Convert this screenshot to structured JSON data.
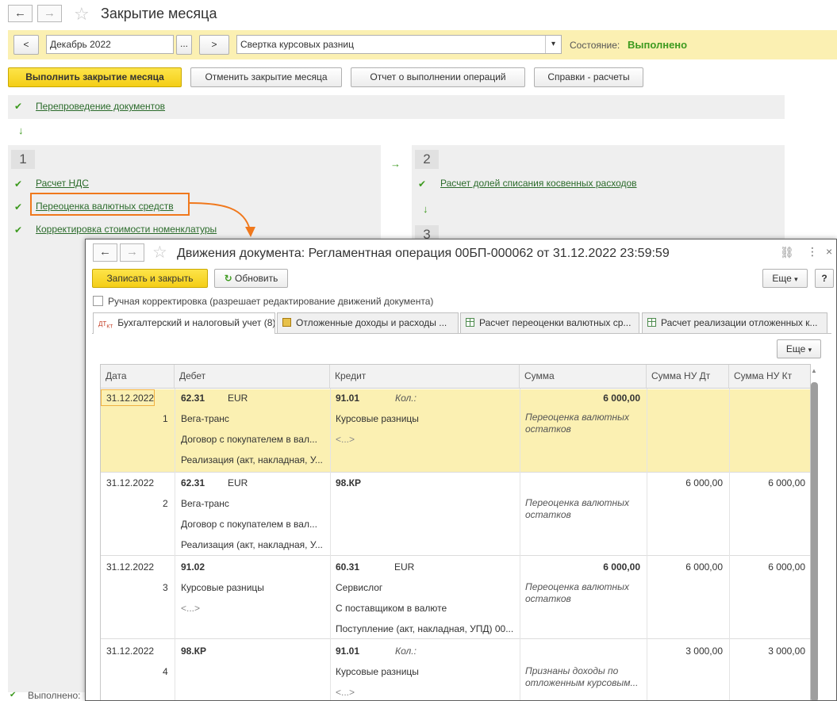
{
  "window": {
    "title": "Закрытие месяца",
    "back_icon": "←",
    "forward_icon": "→"
  },
  "period": {
    "prev_label": "<",
    "value": "Декабрь 2022",
    "select_label": "...",
    "next_label": ">"
  },
  "operation_select": {
    "value": "Свертка курсовых разниц",
    "arrow": "▾"
  },
  "status": {
    "label": "Состояние:",
    "value": "Выполнено"
  },
  "toolbar": {
    "run": "Выполнить закрытие месяца",
    "cancel": "Отменить закрытие месяца",
    "report": "Отчет о выполнении операций",
    "calc": "Справки - расчеты"
  },
  "steps": {
    "repost": "Перепроведение документов",
    "group1_number": "1",
    "group1_items": [
      "Расчет НДС",
      "Переоценка валютных средств",
      "Корректировка стоимости номенклатуры"
    ],
    "group2_number": "2",
    "group2_items": [
      "Расчет долей списания косвенных расходов"
    ],
    "group3_number": "3",
    "footer_status": "Выполнено:"
  },
  "modal": {
    "title": "Движения документа: Регламентная операция 00БП-000062 от 31.12.2022 23:59:59",
    "save_close": "Записать и закрыть",
    "refresh": "Обновить",
    "more": "Еще",
    "help": "?",
    "manual_edit": "Ручная корректировка (разрешает редактирование движений документа)",
    "tabs": [
      "Бухгалтерский и налоговый учет (8)",
      "Отложенные доходы и расходы ...",
      "Расчет переоценки валютных ср...",
      "Расчет реализации отложенных к..."
    ],
    "grid_more": "Еще",
    "columns": [
      "Дата",
      "Дебет",
      "Кредит",
      "Сумма",
      "Сумма НУ Дт",
      "Сумма НУ Кт"
    ],
    "rows": [
      {
        "date": "31.12.2022",
        "num": "1",
        "dt_account": "62.31",
        "dt_currency": "EUR",
        "dt_sub": [
          "Вега-транс",
          "Договор с покупателем в вал...",
          "Реализация (акт, накладная, У..."
        ],
        "kt_account": "91.01",
        "kt_qty": "Кол.:",
        "kt_sub": [
          "Курсовые разницы",
          "<...>"
        ],
        "sum": "6 000,00",
        "nu_dt": "",
        "nu_kt": "",
        "content": "Переоценка валютных остатков"
      },
      {
        "date": "31.12.2022",
        "num": "2",
        "dt_account": "62.31",
        "dt_currency": "EUR",
        "dt_sub": [
          "Вега-транс",
          "Договор с покупателем в вал...",
          "Реализация (акт, накладная, У..."
        ],
        "kt_account": "98.КР",
        "kt_qty": "",
        "kt_sub": [],
        "sum": "",
        "nu_dt": "6 000,00",
        "nu_kt": "6 000,00",
        "content": "Переоценка валютных остатков"
      },
      {
        "date": "31.12.2022",
        "num": "3",
        "dt_account": "91.02",
        "dt_currency": "",
        "dt_sub": [
          "Курсовые разницы",
          "<...>"
        ],
        "kt_account": "60.31",
        "kt_currency": "EUR",
        "kt_sub": [
          "Сервислог",
          "С поставщиком в валюте",
          "Поступление (акт, накладная, УПД) 00..."
        ],
        "sum": "6 000,00",
        "nu_dt": "6 000,00",
        "nu_kt": "6 000,00",
        "content": "Переоценка валютных остатков"
      },
      {
        "date": "31.12.2022",
        "num": "4",
        "dt_account": "98.КР",
        "dt_currency": "",
        "dt_sub": [],
        "kt_account": "91.01",
        "kt_qty": "Кол.:",
        "kt_sub": [
          "Курсовые разницы",
          "<...>"
        ],
        "sum": "",
        "nu_dt": "3 000,00",
        "nu_kt": "3 000,00",
        "content": "Признаны доходы по отложенным курсовым..."
      }
    ]
  },
  "colors": {
    "accent_yellow": "#fbf0b2",
    "highlight_orange": "#f0781c",
    "success_green": "#3d9a1f"
  }
}
